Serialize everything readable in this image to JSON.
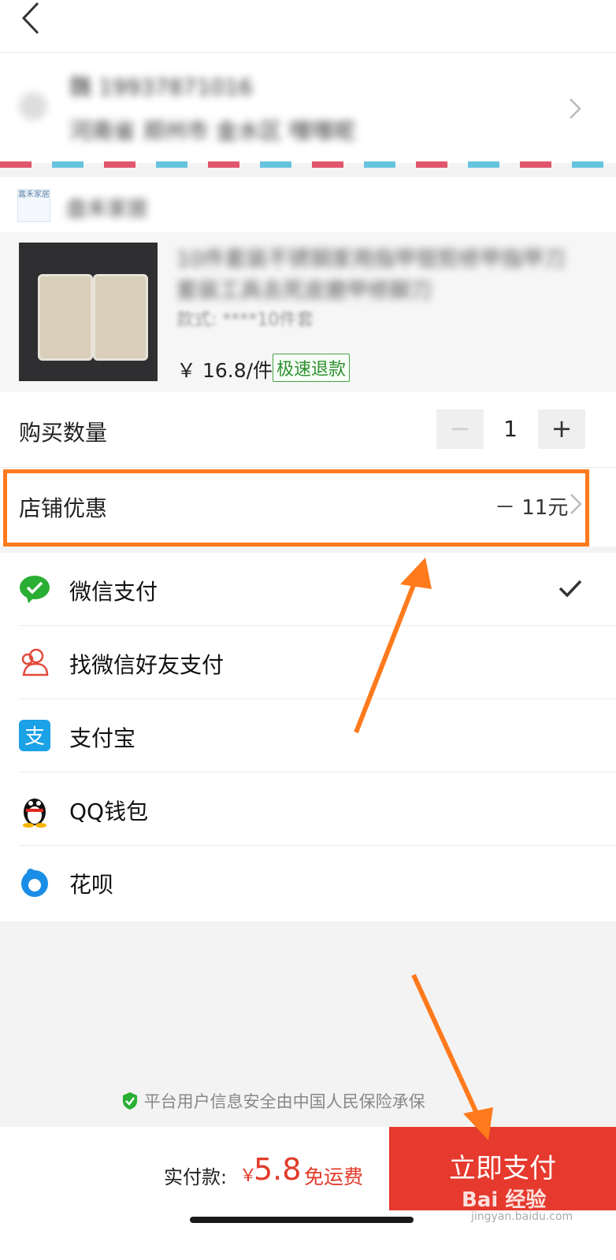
{
  "header": {
    "back_icon": "chevron-left-icon"
  },
  "address": {
    "name_phone": "魏 19937871016",
    "detail": "河南省 郑州市 金水区 嘿嘿呢",
    "pin_icon": "location-pin-icon",
    "chevron_icon": "chevron-right-icon"
  },
  "shop": {
    "logo_text": "嘉禾家居",
    "name": "盘禾家居"
  },
  "product": {
    "title": "10件套装不锈钢家用指甲钳剪修甲指甲刀套装工具去死皮磨甲修脚刀",
    "spec": "款式: ****10件套",
    "price": "￥ 16.8/件",
    "badge": "极速退款"
  },
  "quantity": {
    "label": "购买数量",
    "minus": "−",
    "value": "1",
    "plus": "+"
  },
  "discount": {
    "label": "店铺优惠",
    "value": "－ 11元"
  },
  "payments": {
    "items": [
      {
        "label": "微信支付",
        "icon": "wechat-pay-icon",
        "selected": true
      },
      {
        "label": "找微信好友支付",
        "icon": "friend-pay-icon",
        "selected": false
      },
      {
        "label": "支付宝",
        "icon": "alipay-icon",
        "selected": false
      },
      {
        "label": "QQ钱包",
        "icon": "qq-wallet-icon",
        "selected": false
      },
      {
        "label": "花呗",
        "icon": "huabei-icon",
        "selected": false
      }
    ],
    "check_icon": "checkmark-icon"
  },
  "security": {
    "text": "平台用户信息安全由中国人民保险承保",
    "icon": "shield-check-icon"
  },
  "footer": {
    "total_label": "实付款:",
    "currency": "￥",
    "total_amount": "5.8",
    "shipping": "免运费",
    "pay_button": "立即支付"
  },
  "watermark": {
    "text": "Bai 经验",
    "sub": "jingyan.baidu.com"
  },
  "colors": {
    "accent": "#e53a2d",
    "highlight": "#ff7a1c",
    "wechat_green": "#2aae33",
    "alipay_blue": "#1aa1e6"
  }
}
